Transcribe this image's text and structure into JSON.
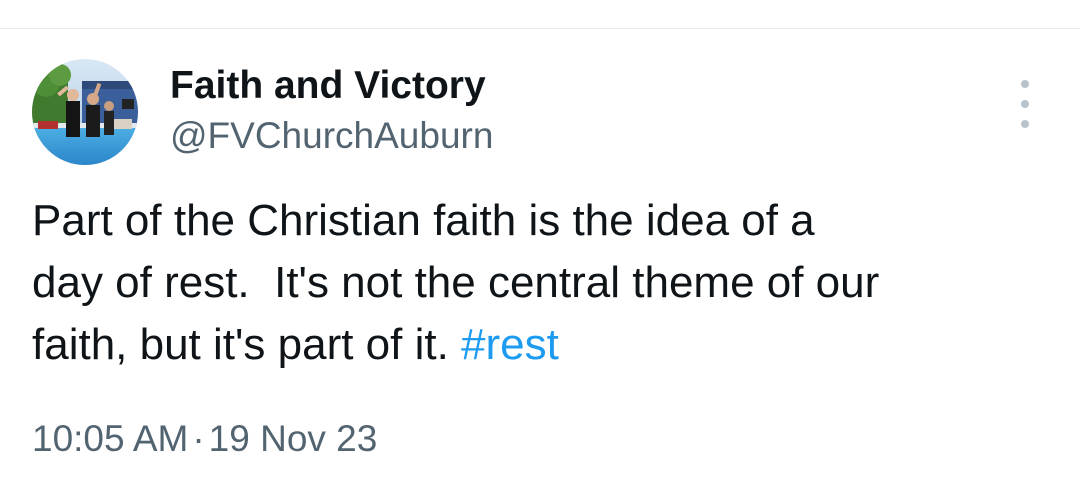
{
  "author": {
    "name": "Faith and Victory",
    "handle": "@FVChurchAuburn",
    "avatar_icon": "profile-photo"
  },
  "menu": {
    "icon": "more-vertical-icon"
  },
  "tweet": {
    "line1": "Part of the Christian faith is the idea of a",
    "line2": "day of rest.  It's not the central theme of our",
    "line3": "faith, but it's part of it. ",
    "hashtag": "#rest"
  },
  "meta": {
    "time": "10:05 AM",
    "separator": "·",
    "date": "19 Nov 23"
  },
  "colors": {
    "text": "#0f1419",
    "secondary": "#536471",
    "link": "#1d9bf0"
  }
}
